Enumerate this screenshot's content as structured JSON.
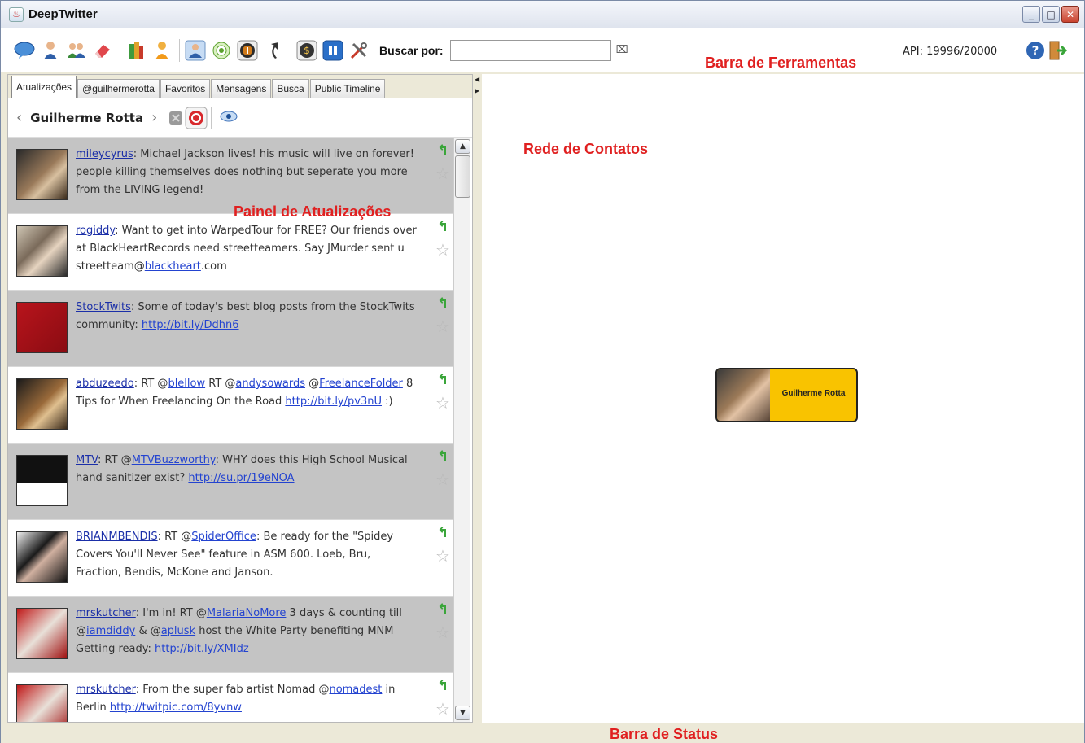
{
  "window": {
    "title": "DeepTwitter",
    "minimize_glyph": "_",
    "maximize_glyph": "□",
    "close_glyph": "✕"
  },
  "toolbar": {
    "icons": [
      "chat-bubble-icon",
      "user-icon",
      "users-icon",
      "eraser-icon",
      "books-icon",
      "person-add-icon",
      "user-profile-icon",
      "target-icon",
      "info-icon",
      "back-icon",
      "dollar-icon",
      "pause-icon",
      "tools-icon"
    ],
    "search_label": "Buscar por:",
    "search_value": "",
    "search_clear": "⌧",
    "api_status": "API: 19996/20000",
    "help_glyph": "?"
  },
  "annotations": {
    "toolbar_label": "Barra de Ferramentas",
    "contacts_label": "Rede de Contatos",
    "updates_label": "Painel de Atualizações",
    "status_label": "Barra de Status"
  },
  "tabs": [
    {
      "label": "Atualizações",
      "active": true
    },
    {
      "label": "@guilhermerotta",
      "active": false
    },
    {
      "label": "Favoritos",
      "active": false
    },
    {
      "label": "Mensagens",
      "active": false
    },
    {
      "label": "Busca",
      "active": false
    },
    {
      "label": "Public Timeline",
      "active": false
    }
  ],
  "userbar": {
    "prev": "‹",
    "name": "Guilherme Rotta",
    "next": "›"
  },
  "tweets": [
    {
      "user": "mileycyrus",
      "segments": [
        {
          "t": ": Michael Jackson lives! his music will live on forever! people killing themselves does nothing but seperate you more from the LIVING legend!"
        }
      ]
    },
    {
      "user": "rogiddy",
      "segments": [
        {
          "t": ": Want to get into WarpedTour for FREE? Our friends over at BlackHeartRecords need streetteamers. Say JMurder sent u streetteam@"
        },
        {
          "l": "blackheart"
        },
        {
          "t": ".com"
        }
      ]
    },
    {
      "user": "StockTwits",
      "segments": [
        {
          "t": ": Some of today's best blog posts from the StockTwits community: "
        },
        {
          "l": "http://bit.ly/Ddhn6"
        }
      ]
    },
    {
      "user": "abduzeedo",
      "segments": [
        {
          "t": ": RT @"
        },
        {
          "l": "blellow"
        },
        {
          "t": " RT @"
        },
        {
          "l": "andysowards"
        },
        {
          "t": " @"
        },
        {
          "l": "FreelanceFolder"
        },
        {
          "t": " 8 Tips for When Freelancing On the Road "
        },
        {
          "l": "http://bit.ly/pv3nU"
        },
        {
          "t": " :)"
        }
      ]
    },
    {
      "user": "MTV",
      "segments": [
        {
          "t": ": RT @"
        },
        {
          "l": "MTVBuzzworthy"
        },
        {
          "t": ": WHY does this High School Musical hand sanitizer exist? "
        },
        {
          "l": "http://su.pr/19eNOA"
        }
      ]
    },
    {
      "user": "BRIANMBENDIS",
      "segments": [
        {
          "t": ": RT @"
        },
        {
          "l": "SpiderOffice"
        },
        {
          "t": ": Be ready for the \"Spidey Covers You'll Never See\" feature in ASM 600. Loeb, Bru, Fraction, Bendis, McKone and Janson."
        }
      ]
    },
    {
      "user": "mrskutcher",
      "segments": [
        {
          "t": ": I'm in! RT @"
        },
        {
          "l": "MalariaNoMore"
        },
        {
          "t": " 3 days & counting till @"
        },
        {
          "l": "iamdiddy"
        },
        {
          "t": " & @"
        },
        {
          "l": "aplusk"
        },
        {
          "t": " host the White Party benefiting MNM Getting ready: "
        },
        {
          "l": "http://bit.ly/XMIdz"
        }
      ]
    },
    {
      "user": "mrskutcher",
      "segments": [
        {
          "t": ": From the super fab artist Nomad @"
        },
        {
          "l": "nomadest"
        },
        {
          "t": " in Berlin "
        },
        {
          "l": "http://twitpic.com/8yvnw"
        }
      ]
    }
  ],
  "graph": {
    "node_name": "Guilherme Rotta"
  },
  "colors": {
    "annotation_red": "#e02020",
    "node_fill": "#f9c300",
    "row_gray": "#c4c4c4"
  }
}
